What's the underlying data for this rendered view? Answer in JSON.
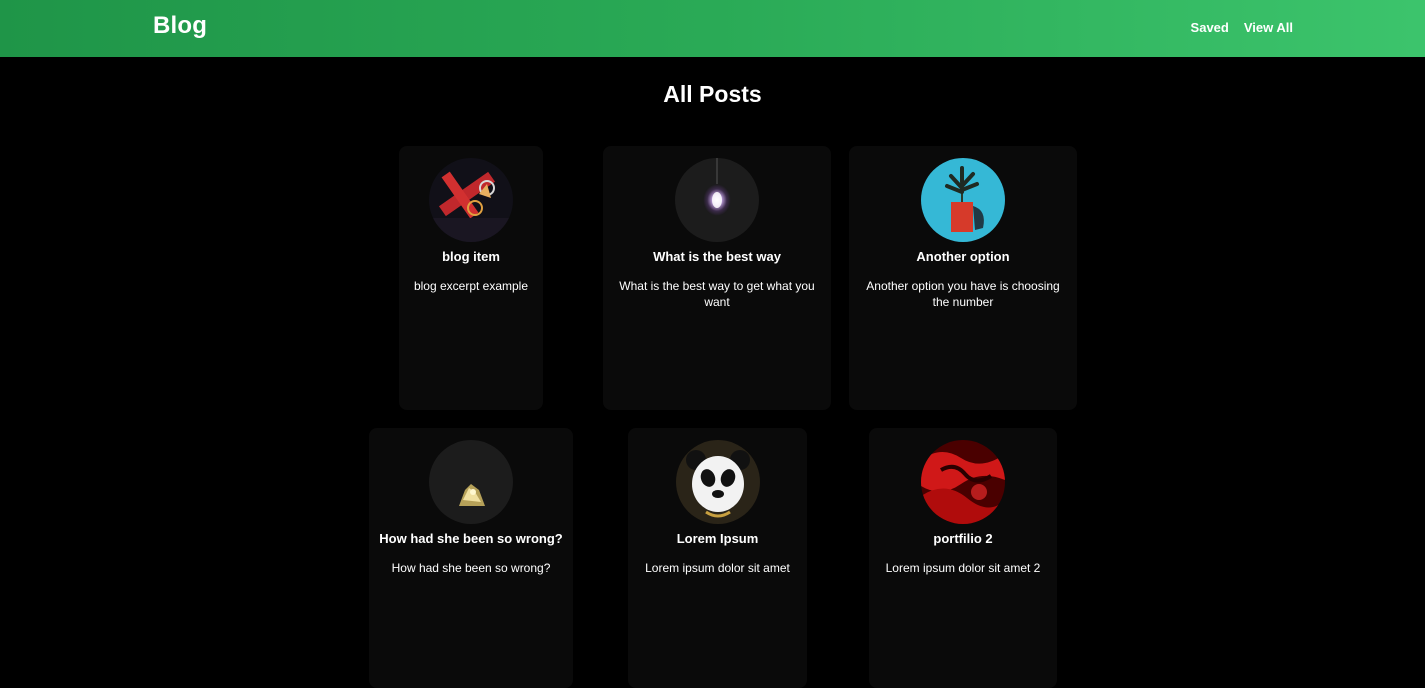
{
  "navbar": {
    "brand": "Blog",
    "links": [
      {
        "label": "Saved"
      },
      {
        "label": "View All"
      }
    ],
    "accent": "#2aaa56"
  },
  "main": {
    "title": "All Posts"
  },
  "posts": [
    {
      "title": "blog item",
      "excerpt": "blog excerpt example",
      "image_icon": "motorbike-stunt-image"
    },
    {
      "title": "What is the best way",
      "excerpt": "What is the best way to get what you want",
      "image_icon": "light-bulb-image"
    },
    {
      "title": "Another option",
      "excerpt": "Another option you have is choosing the number",
      "image_icon": "plant-pot-image"
    },
    {
      "title": "How had she been so wrong?",
      "excerpt": "How had she been so wrong?",
      "image_icon": "sparkler-image"
    },
    {
      "title": "Lorem Ipsum",
      "excerpt": "Lorem ipsum dolor sit amet",
      "image_icon": "panda-image"
    },
    {
      "title": "portfilio 2",
      "excerpt": "Lorem ipsum dolor sit amet 2",
      "image_icon": "red-abstract-image"
    }
  ]
}
